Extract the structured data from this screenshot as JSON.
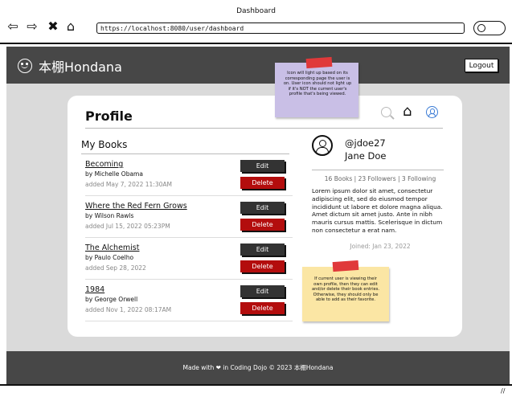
{
  "window": {
    "title": "Dashboard"
  },
  "browser": {
    "url": "https://localhost:8080/user/dashboard",
    "back_icon": "arrow-left",
    "forward_icon": "arrow-right",
    "close_icon": "x",
    "home_icon": "house"
  },
  "nav": {
    "brand": "本棚Hondana",
    "logout": "Logout"
  },
  "profile": {
    "title": "Profile",
    "my_books": "My Books",
    "books": [
      {
        "title": "Becoming",
        "author": "by Michelle Obama",
        "added": "added May 7, 2022 11:30AM",
        "edit": "Edit",
        "delete": "Delete"
      },
      {
        "title": "Where the Red Fern Grows",
        "author": "by Wilson Rawls",
        "added": "added Jul 15, 2022 05:23PM",
        "edit": "Edit",
        "delete": "Delete"
      },
      {
        "title": "The Alchemist",
        "author": "by Paulo Coelho",
        "added": "added Sep 28, 2022",
        "edit": "Edit",
        "delete": "Delete"
      },
      {
        "title": "1984",
        "author": "by George Orwell",
        "added": "added Nov 1, 2022 08:17AM",
        "edit": "Edit",
        "delete": "Delete"
      }
    ],
    "user": {
      "handle": "@jdoe27",
      "name": "Jane Doe",
      "stats": "16 Books | 23 Followers | 3 Following",
      "bio": "Lorem ipsum dolor sit amet, consectetur adipiscing elit, sed do eiusmod tempor incididunt ut labore et dolore magna aliqua. Amet dictum sit amet justo. Ante in nibh mauris cursus mattis. Scelerisque in dictum non consectetur a erat nam.",
      "joined": "Joined: Jan 23, 2022"
    }
  },
  "notes": {
    "icon_note": "Icon will light up based on its corresponding page the user is on. User icon should not light up if it's NOT the current user's profile that's being viewed.",
    "owner_note": "If current user is viewing their own profile, then they can edit and/or delete their book entries. Otherwise, they should only be able to add as their favorite."
  },
  "footer": {
    "text": "Made with ❤ in Coding Dojo © 2023 本棚Hondana"
  },
  "colors": {
    "nav": "#474747",
    "delete": "#b30d0d",
    "edit": "#333333",
    "active_icon": "#3a7bd5"
  }
}
